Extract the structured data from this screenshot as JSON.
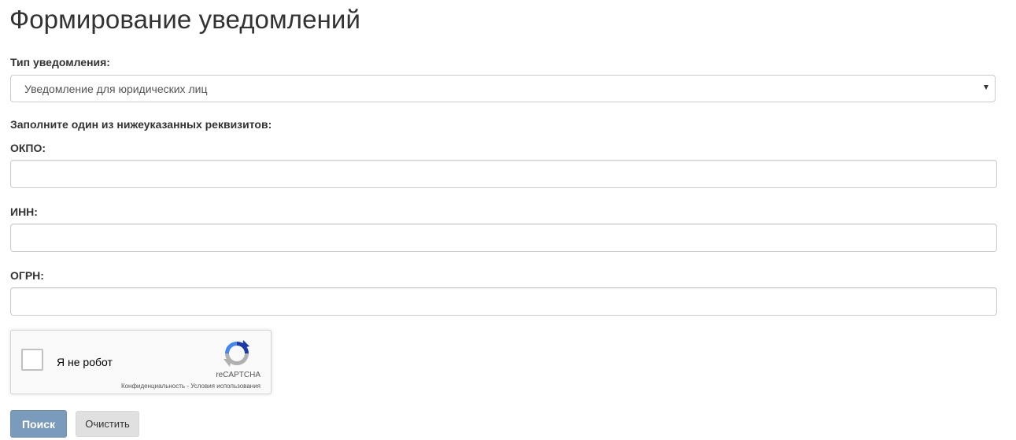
{
  "page": {
    "title": "Формирование уведомлений"
  },
  "form": {
    "notification_type_label": "Тип уведомления:",
    "notification_type_selected": "Уведомление для юридических лиц",
    "instruction": "Заполните один из нижеуказанных реквизитов:",
    "okpo_label": "ОКПО:",
    "okpo_value": "",
    "inn_label": "ИНН:",
    "inn_value": "",
    "ogrn_label": "ОГРН:",
    "ogrn_value": ""
  },
  "recaptcha": {
    "checkbox_label": "Я не робот",
    "brand": "reCAPTCHA",
    "privacy_link": "Конфиденциальность",
    "separator": " - ",
    "terms_link": "Условия использования",
    "logo_icon": "recaptcha-logo-icon"
  },
  "buttons": {
    "search_label": "Поиск",
    "clear_label": "Очистить"
  },
  "colors": {
    "search_button_bg": "#7b9bbd",
    "clear_button_bg": "#e0e0e0",
    "recaptcha_blue": "#1c3aa9",
    "recaptcha_light_blue": "#4285f4",
    "recaptcha_gray": "#b0b0b0"
  }
}
